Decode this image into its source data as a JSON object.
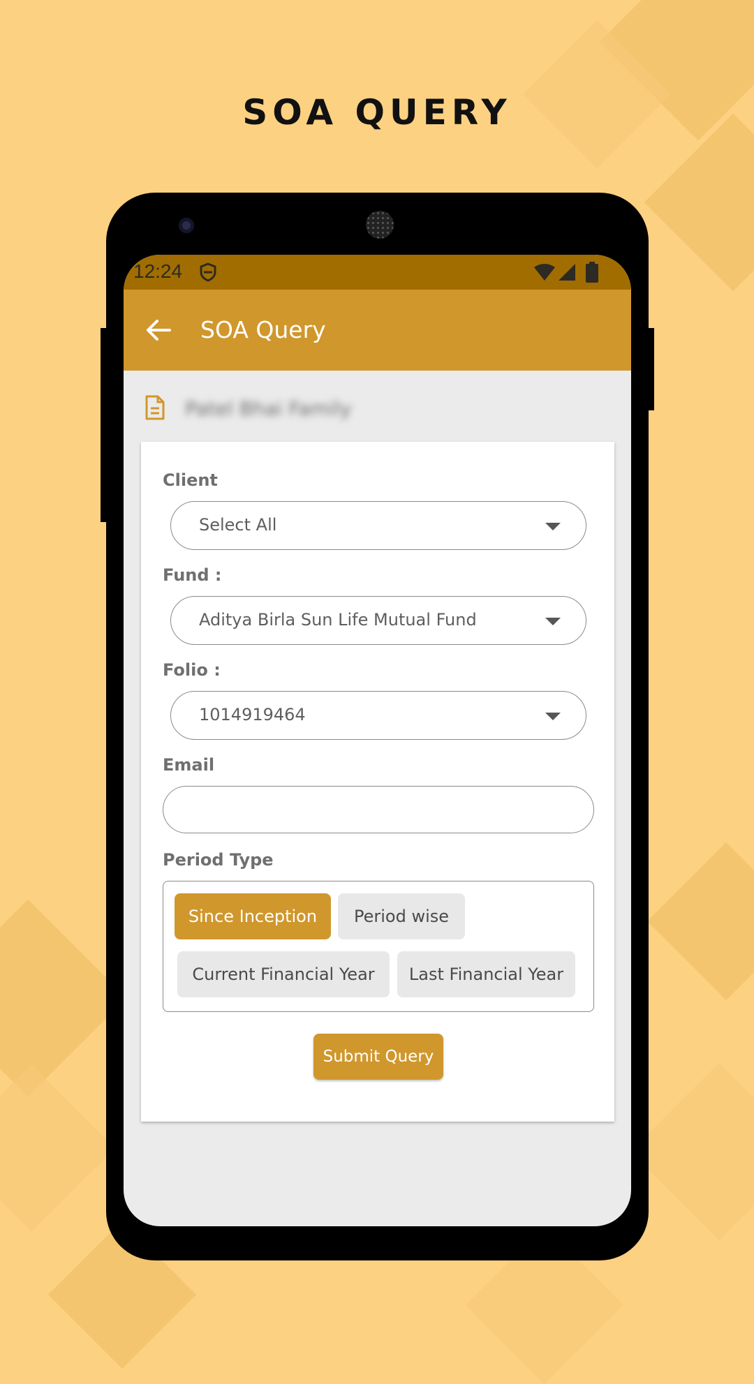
{
  "promo": {
    "title": "SOA QUERY"
  },
  "status_bar": {
    "time": "12:24",
    "icons": [
      "shield-icon",
      "wifi-icon",
      "signal-icon",
      "battery-icon"
    ]
  },
  "app_bar": {
    "title": "SOA Query",
    "back_icon": "arrow-left-icon"
  },
  "header": {
    "icon": "document-icon",
    "client_name": "Patel Bhai Family"
  },
  "form": {
    "client": {
      "label": "Client",
      "value": "Select All"
    },
    "fund": {
      "label": "Fund :",
      "value": "Aditya Birla Sun Life Mutual Fund"
    },
    "folio": {
      "label": "Folio :",
      "value": "1014919464"
    },
    "email": {
      "label": "Email",
      "value": "",
      "placeholder": ""
    },
    "period_type": {
      "label": "Period Type",
      "options": [
        "Since Inception",
        "Period wise",
        "Current Financial Year",
        "Last Financial Year"
      ],
      "selected": "Since Inception"
    },
    "submit_label": "Submit Query"
  },
  "colors": {
    "background": "#fdd182",
    "status_bar": "#a16d00",
    "accent": "#d0972c",
    "chip_inactive": "#e8e8e8"
  }
}
